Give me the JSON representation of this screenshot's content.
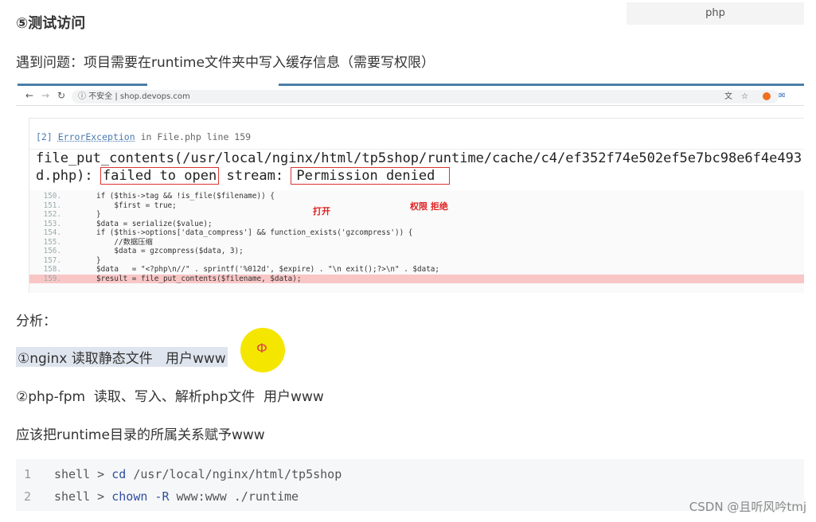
{
  "heading": "⑤测试访问",
  "tag_label": "php",
  "problem": "遇到问题：项目需要在runtime文件夹中写入缓存信息（需要写权限）",
  "browser": {
    "security": "不安全",
    "url": "shop.devops.com"
  },
  "error": {
    "header_prefix": "[2]",
    "header_link": "ErrorException",
    "header_suffix": "in File.php line 159",
    "msg_line1": "file_put_contents(/usr/local/nginx/html/tp5shop/runtime/cache/c4/ef352f74e502ef5e7bc98e6f4e493",
    "msg_line2_a": "d.php):",
    "msg_failed": "failed to open",
    "msg_stream": "stream:",
    "msg_denied": "Permission denied",
    "annot_open": "打开",
    "annot_denied": "权限 拒绝",
    "code_lines": [
      {
        "n": "150.",
        "t": "if ($this->tag && !is_file($filename)) {"
      },
      {
        "n": "151.",
        "t": "    $first = true;"
      },
      {
        "n": "152.",
        "t": "}"
      },
      {
        "n": "153.",
        "t": "$data = serialize($value);"
      },
      {
        "n": "154.",
        "t": "if ($this->options['data_compress'] && function_exists('gzcompress')) {"
      },
      {
        "n": "155.",
        "t": "    //数据压缩"
      },
      {
        "n": "156.",
        "t": "    $data = gzcompress($data, 3);"
      },
      {
        "n": "157.",
        "t": "}"
      },
      {
        "n": "158.",
        "t": "$data   = \"<?php\\n//\" . sprintf('%012d', $expire) . \"\\n exit();?>\\n\" . $data;"
      },
      {
        "n": "159.",
        "t": "$result = file_put_contents($filename, $data);"
      }
    ]
  },
  "analysis": "分析：",
  "point1": "①nginx 读取静态文件   用户www",
  "point2": "②php-fpm  读取、写入、解析php文件  用户www",
  "conclusion": "应该把runtime目录的所属关系赋予www",
  "shell": [
    {
      "num": "1",
      "prompt": "shell > ",
      "cmd": "cd",
      "rest": " /usr/local/nginx/html/tp5shop"
    },
    {
      "num": "2",
      "prompt": "shell > ",
      "cmd": "chown -R",
      "rest": " www:www ./runtime"
    }
  ],
  "watermark": "CSDN @且听风吟tmj",
  "colors": {
    "highlight_row": "#f9c6c6",
    "red_box": "#dd3333",
    "cursor": "#f5e600"
  }
}
